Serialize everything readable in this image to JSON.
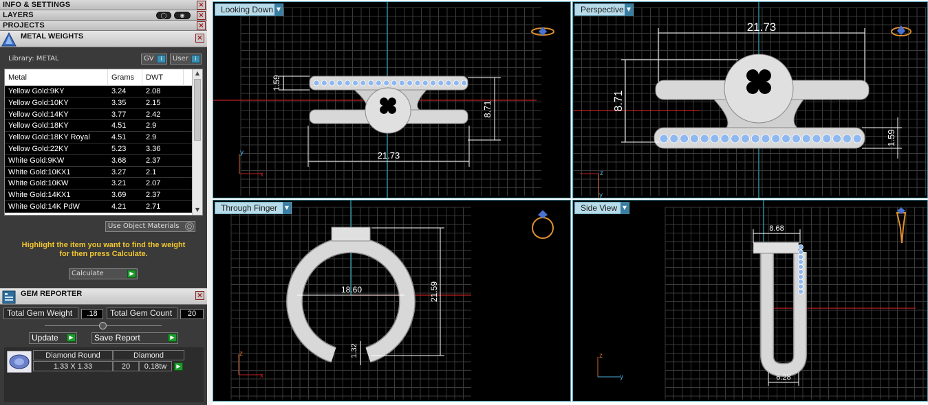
{
  "panels": {
    "info_settings": "INFO & SETTINGS",
    "layers": "LAYERS",
    "projects": "PROJECTS"
  },
  "metal_weights": {
    "title": "METAL WEIGHTS",
    "library_label": "Library: METAL",
    "gv_label": "GV",
    "user_label": "User",
    "columns": [
      "Metal",
      "Grams",
      "DWT"
    ],
    "rows": [
      {
        "metal": "Yellow Gold:9KY",
        "grams": "3.24",
        "dwt": "2.08"
      },
      {
        "metal": "Yellow Gold:10KY",
        "grams": "3.35",
        "dwt": "2.15"
      },
      {
        "metal": "Yellow Gold:14KY",
        "grams": "3.77",
        "dwt": "2.42"
      },
      {
        "metal": "Yellow Gold:18KY",
        "grams": "4.51",
        "dwt": "2.9"
      },
      {
        "metal": "Yellow Gold:18KY Royal",
        "grams": "4.51",
        "dwt": "2.9"
      },
      {
        "metal": "Yellow Gold:22KY",
        "grams": "5.23",
        "dwt": "3.36"
      },
      {
        "metal": "White Gold:9KW",
        "grams": "3.68",
        "dwt": "2.37"
      },
      {
        "metal": "White Gold:10KX1",
        "grams": "3.27",
        "dwt": "2.1"
      },
      {
        "metal": "White Gold:10KW",
        "grams": "3.21",
        "dwt": "2.07"
      },
      {
        "metal": "White Gold:14KX1",
        "grams": "3.69",
        "dwt": "2.37"
      },
      {
        "metal": "White Gold:14K PdW",
        "grams": "4.21",
        "dwt": "2.71"
      }
    ],
    "use_object_materials": "Use Object Materials",
    "hint_line1": "Highlight the item you want to find the weight",
    "hint_line2": "for then press Calculate.",
    "calculate_label": "Calculate"
  },
  "gem_reporter": {
    "title": "GEM REPORTER",
    "total_weight_label": "Total Gem Weight",
    "total_weight_value": ".18",
    "total_count_label": "Total Gem Count",
    "total_count_value": "20",
    "update_label": "Update",
    "save_report_label": "Save Report",
    "gem": {
      "shape": "Diamond Round",
      "material": "Diamond",
      "size": "1.33 X 1.33",
      "count": "20",
      "weight": "0.18tw"
    }
  },
  "viewports": {
    "top_left": {
      "label": "Looking Down",
      "dim_width": "21.73",
      "dim_height": "8.71",
      "dim_band": "1.59",
      "axis_a": "y",
      "axis_b": "x"
    },
    "top_right": {
      "label": "Perspective",
      "dim_width": "21.73",
      "dim_height": "8.71",
      "dim_band": "1.59",
      "axis_a": "z",
      "axis_b": "y"
    },
    "bottom_left": {
      "label": "Through Finger",
      "dim_inner": "18.60",
      "dim_outer": "21.59",
      "dim_gap": "1.32",
      "axis_a": "z",
      "axis_b": "x"
    },
    "bottom_right": {
      "label": "Side View",
      "dim_top": "8.68",
      "dim_bottom": "6.28",
      "axis_a": "z",
      "axis_b": "y"
    }
  },
  "colors": {
    "accent_blue": "#b8dbe9",
    "hint_yellow": "#f2c630",
    "axis_red": "#c02020",
    "axis_teal": "#2a8a9a",
    "gem_blue": "#8fb8f0"
  }
}
